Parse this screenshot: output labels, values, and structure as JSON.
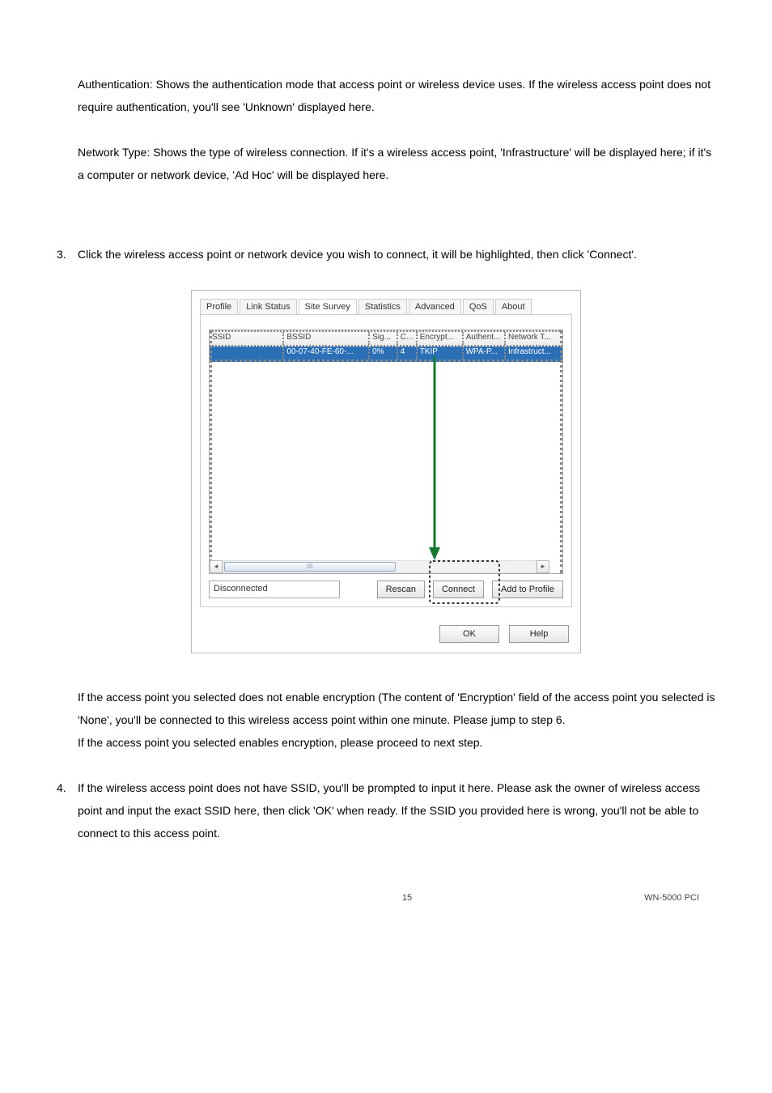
{
  "para_auth": "Authentication: Shows the authentication mode that access point or wireless device uses. If the wireless access point does not require authentication, you'll see 'Unknown' displayed here.",
  "para_net": "Network Type: Shows the type of wireless connection. If it's a wireless access point, 'Infrastructure' will be displayed here; if it's a computer or network device, 'Ad Hoc' will be displayed here.",
  "step3_num": "3.",
  "step3_text": "Click the wireless access point or network device you wish to connect, it will be highlighted, then click 'Connect'.",
  "dialog": {
    "tabs": {
      "profile": "Profile",
      "link": "Link Status",
      "site": "Site Survey",
      "stats": "Statistics",
      "adv": "Advanced",
      "qos": "QoS",
      "about": "About"
    },
    "headers": {
      "ssid": "SSID",
      "bssid": "BSSID",
      "sig": "Sig...",
      "ch": "C...",
      "enc": "Encrypt...",
      "auth": "Authent...",
      "net": "Network T..."
    },
    "row": {
      "ssid": "",
      "bssid": "00-07-40-FE-60-...",
      "sig": "0%",
      "ch": "4",
      "enc": "TKIP",
      "auth": "WPA-P...",
      "net": "Infrastruct..."
    },
    "scroll_mid": "III",
    "status": "Disconnected",
    "rescan": "Rescan",
    "connect": "Connect",
    "add": "Add to Profile",
    "ok": "OK",
    "help": "Help",
    "scroll_left": "◂",
    "scroll_right": "▸"
  },
  "post1": "If the access point you selected does not enable encryption (The content of 'Encryption' field of the access point you selected is 'None', you'll be connected to this wireless access point within one minute. Please jump to step 6.",
  "post2": "If the access point you selected enables encryption, please proceed to next step.",
  "step4_num": "4.",
  "step4_text": "If the wireless access point does not have SSID, you'll be prompted to input it here. Please ask the owner of wireless access point and input the exact SSID here, then click 'OK' when ready. If the SSID you provided here is wrong, you'll not be able to connect to this access point.",
  "footer_page": "15",
  "footer_model": "WN-5000 PCI"
}
